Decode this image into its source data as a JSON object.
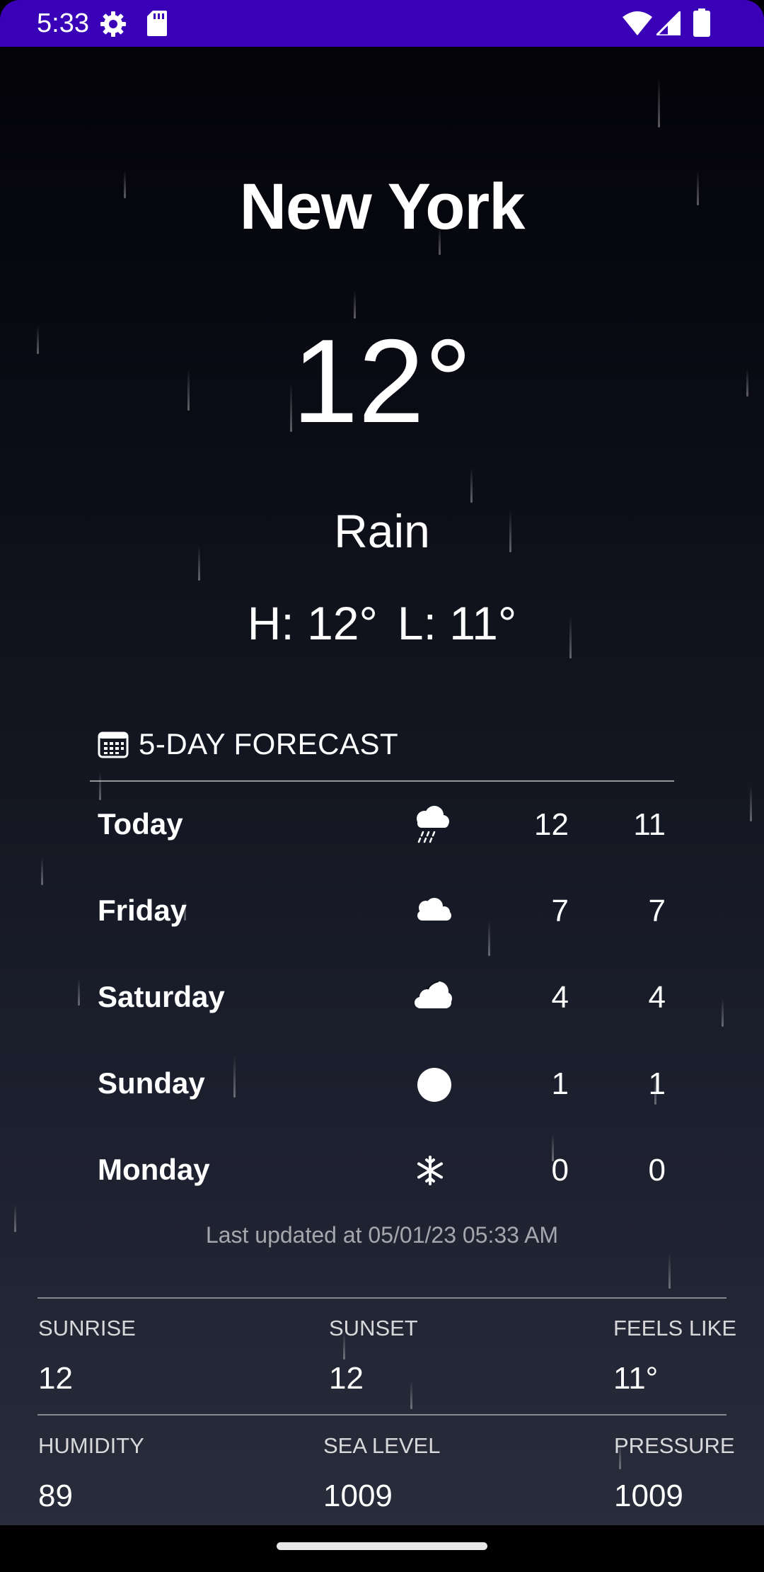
{
  "status_bar": {
    "time": "5:33",
    "icons": [
      "settings-gear-icon",
      "sd-card-icon",
      "wifi-icon",
      "cell-signal-icon",
      "battery-icon"
    ],
    "background_color": "#3a00b8"
  },
  "weather": {
    "city": "New York",
    "temperature": "12°",
    "condition": "Rain",
    "high": "H: 12°",
    "low": "L: 11°"
  },
  "forecast": {
    "title": "5-DAY FORECAST",
    "title_icon": "calendar-icon",
    "days": [
      {
        "day": "Today",
        "icon": "rain-cloud-icon",
        "high": "12",
        "low": "11"
      },
      {
        "day": "Friday",
        "icon": "cloud-icon",
        "high": "7",
        "low": "7"
      },
      {
        "day": "Saturday",
        "icon": "clouds-icon",
        "high": "4",
        "low": "4"
      },
      {
        "day": "Sunday",
        "icon": "sun-icon",
        "high": "1",
        "low": "1"
      },
      {
        "day": "Monday",
        "icon": "snowflake-icon",
        "high": "0",
        "low": "0"
      }
    ],
    "last_updated": "Last updated at 05/01/23 05:33 AM"
  },
  "details": {
    "sunrise": {
      "label": "SUNRISE",
      "value": "12"
    },
    "sunset": {
      "label": "SUNSET",
      "value": "12"
    },
    "feels_like": {
      "label": "FEELS LIKE",
      "value": "11°"
    },
    "humidity": {
      "label": "HUMIDITY",
      "value": "89"
    },
    "sea_level": {
      "label": "SEA LEVEL",
      "value": "1009"
    },
    "pressure": {
      "label": "PRESSURE",
      "value": "1009"
    }
  }
}
